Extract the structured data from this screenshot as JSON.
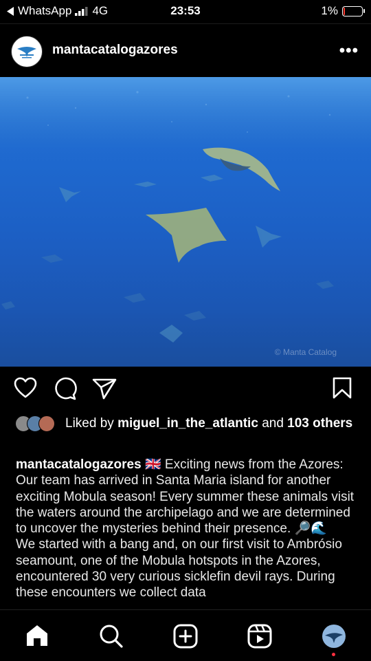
{
  "status": {
    "back_app": "WhatsApp",
    "network": "4G",
    "time": "23:53",
    "battery_text": "1%",
    "battery_level": 0.01
  },
  "post": {
    "username": "mantacatalogazores",
    "watermark": "© Manta Catalog",
    "likes": {
      "prefix": "Liked by",
      "user": "miguel_in_the_atlantic",
      "middle": "and",
      "count": "103 others"
    },
    "caption": {
      "username": "mantacatalogazores",
      "para1": "🇬🇧 Exciting news from the Azores: Our team has arrived in Santa Maria island for another exciting Mobula season! Every summer these animals visit the waters around the archipelago and we are determined to uncover the mysteries behind their presence. 🔎🌊",
      "para2": "We started with a bang and, on our first visit to Ambrósio seamount, one of the Mobula hotspots in the Azores, encountered 30 very curious sicklefin devil rays. During these encounters we collect data"
    }
  },
  "icons": {
    "status": [
      "back-arrow-icon",
      "signal-bars-icon",
      "battery-icon"
    ],
    "post": [
      "more-options-icon",
      "heart-icon",
      "comment-icon",
      "share-icon",
      "bookmark-icon"
    ],
    "nav": [
      "home-icon",
      "search-icon",
      "create-post-icon",
      "reels-icon",
      "profile-avatar-icon"
    ]
  },
  "colors": {
    "background": "#000000",
    "text": "#ffffff",
    "battery_low": "#ff3b30",
    "notification": "#ff3040",
    "ocean": "#1f66c8"
  }
}
